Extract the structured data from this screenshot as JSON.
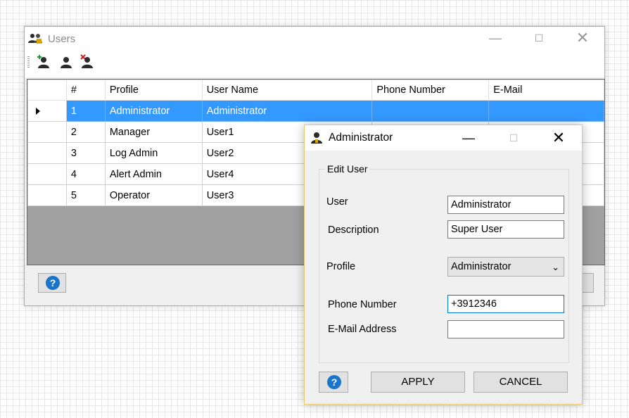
{
  "users_window": {
    "title": "Users",
    "title_icon": "users-icon",
    "controls": {
      "minimize": "—",
      "maximize": "☐",
      "close": "✕"
    },
    "toolbar": {
      "add_icon": "add-user-icon",
      "edit_icon": "user-icon",
      "delete_icon": "delete-user-icon"
    },
    "columns": [
      "#",
      "Profile",
      "User Name",
      "Phone Number",
      "E-Mail"
    ],
    "rows": [
      {
        "num": "1",
        "profile": "Administrator",
        "user_name": "Administrator",
        "phone": "",
        "email": ""
      },
      {
        "num": "2",
        "profile": "Manager",
        "user_name": "User1",
        "phone": "",
        "email": ""
      },
      {
        "num": "3",
        "profile": "Log Admin",
        "user_name": "User2",
        "phone": "",
        "email": ""
      },
      {
        "num": "4",
        "profile": "Alert Admin",
        "user_name": "User4",
        "phone": "",
        "email": ""
      },
      {
        "num": "5",
        "profile": "Operator",
        "user_name": "User3",
        "phone": "",
        "email": ""
      }
    ],
    "selected_row": 1,
    "help_glyph": "?"
  },
  "edit_dialog": {
    "title": "Administrator",
    "title_icon": "user-icon",
    "controls": {
      "minimize": "—",
      "maximize": "☐",
      "close": "✕"
    },
    "group_title": "Edit User",
    "fields": {
      "user": {
        "label": "User",
        "value": "Administrator"
      },
      "description": {
        "label": "Description",
        "value": "Super User"
      },
      "profile": {
        "label": "Profile",
        "value": "Administrator"
      },
      "phone": {
        "label": "Phone Number",
        "value": "+3912346"
      },
      "email": {
        "label": "E-Mail Address",
        "value": ""
      }
    },
    "help_glyph": "?",
    "apply_label": "APPLY",
    "cancel_label": "CANCEL"
  },
  "colors": {
    "selection": "#3399ff",
    "focus_border": "#0078d7",
    "dialog_border": "#e8c86a",
    "help_icon": "#1a74c9"
  }
}
